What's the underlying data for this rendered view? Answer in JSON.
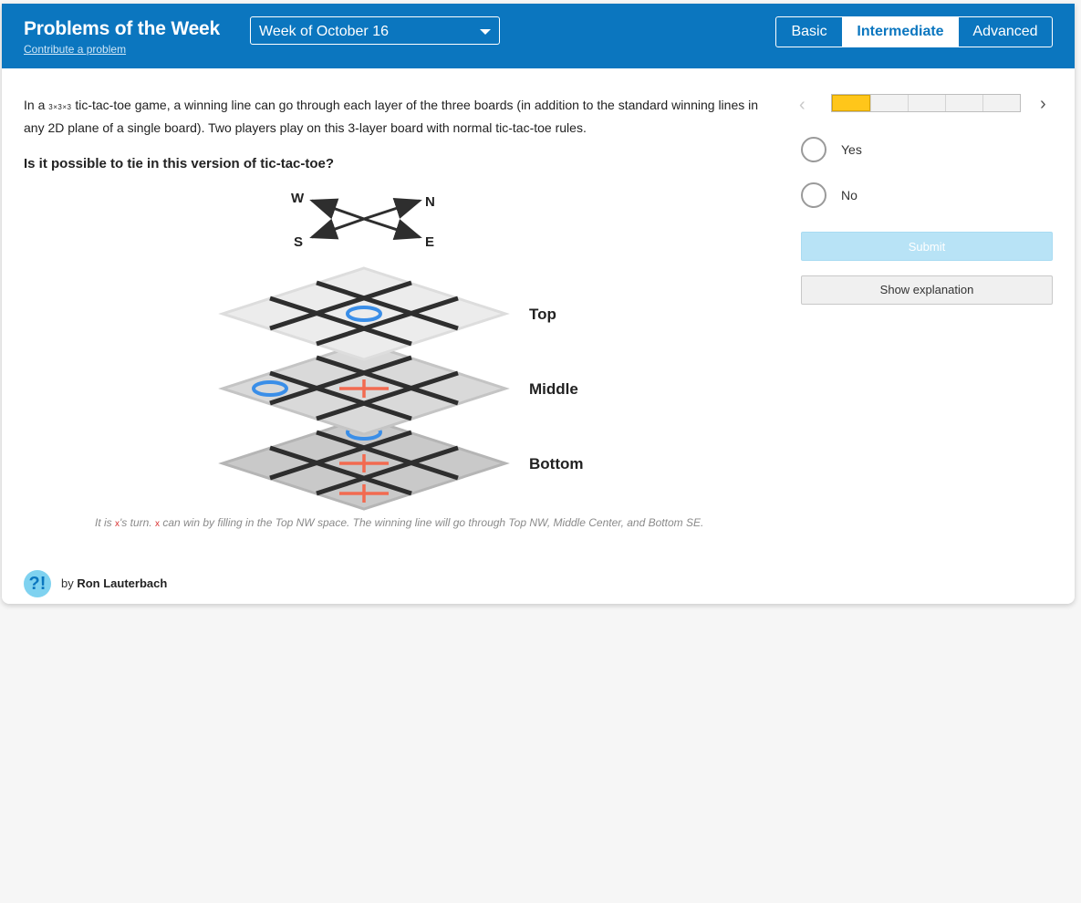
{
  "header": {
    "title": "Problems of the Week",
    "contribute_link": "Contribute a problem",
    "week_select": "Week of October 16",
    "levels": [
      {
        "label": "Basic",
        "active": false
      },
      {
        "label": "Intermediate",
        "active": true
      },
      {
        "label": "Advanced",
        "active": false
      }
    ]
  },
  "problem": {
    "text_a": "In a ",
    "dims": "3×3×3",
    "text_b": " tic-tac-toe game, a winning line can go through each layer of the three boards (in addition to the standard winning lines in any 2D plane of a single board). Two players play on this 3-layer board with normal tic-tac-toe rules.",
    "question": "Is it possible to tie in this version of tic-tac-toe?"
  },
  "figure": {
    "compass": {
      "w": "W",
      "n": "N",
      "s": "S",
      "e": "E"
    },
    "layers": [
      {
        "label": "Top",
        "fill": "#ececec"
      },
      {
        "label": "Middle",
        "fill": "#d9d9d9"
      },
      {
        "label": "Bottom",
        "fill": "#c9c9c9"
      }
    ],
    "colors": {
      "o": "#3a8ee8",
      "x": "#f26a50",
      "lines": "#2e2e2e"
    },
    "caption_a": "It is ",
    "caption_x1": "x",
    "caption_b": "'s turn. ",
    "caption_x2": "x",
    "caption_c": " can win by filling in the Top NW space. The winning line will go through Top NW, Middle Center, and Bottom SE."
  },
  "author": {
    "logo": "?!",
    "by": "by ",
    "name": "Ron Lauterbach"
  },
  "panel": {
    "prev_icon": "‹",
    "next_icon": "›",
    "progress_current": 1,
    "progress_total": 5,
    "choices": [
      "Yes",
      "No"
    ],
    "submit": "Submit",
    "explain": "Show explanation"
  }
}
